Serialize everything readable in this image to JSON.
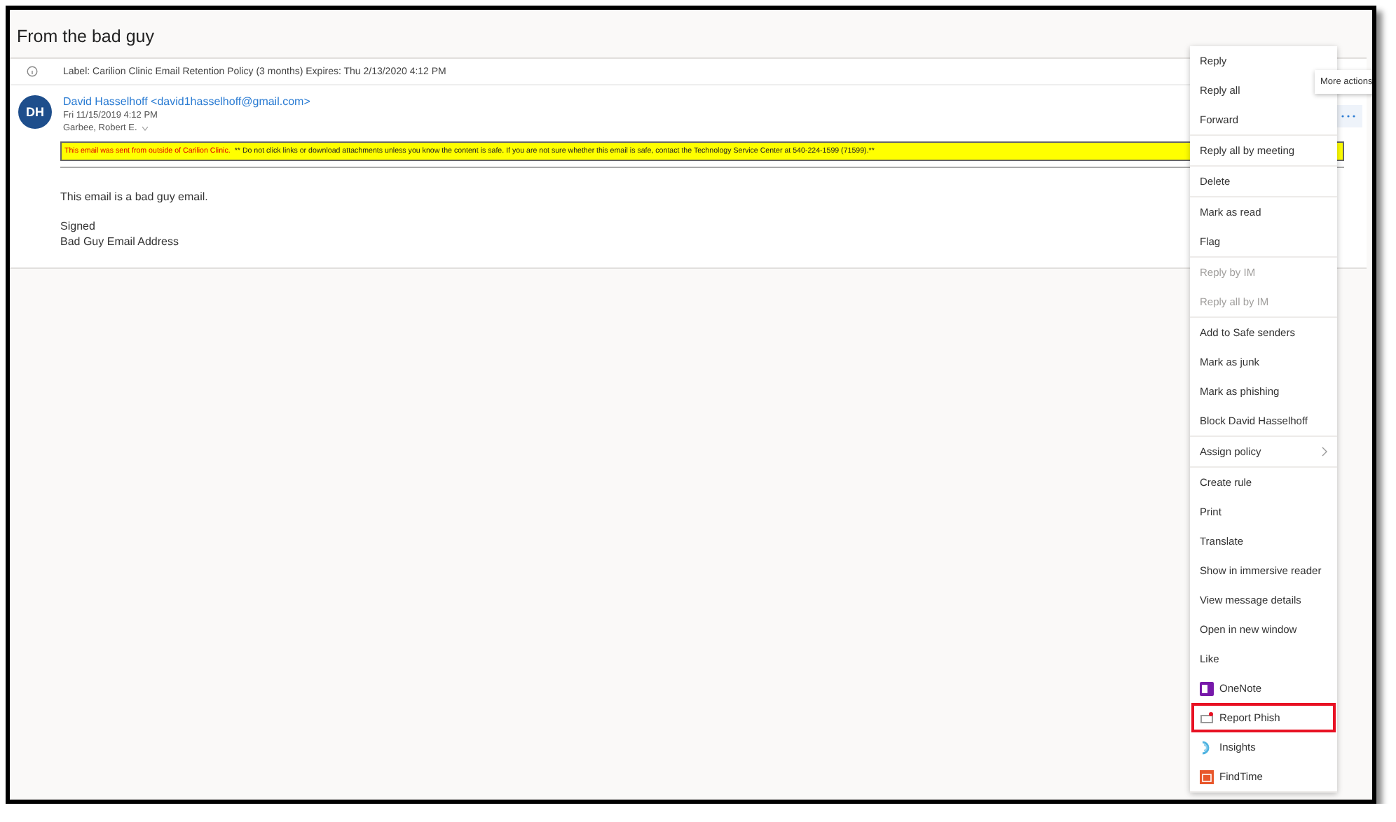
{
  "subject": "From the bad guy",
  "retention_label": "Label: Carilion Clinic Email Retention Policy (3 months) Expires: Thu 2/13/2020 4:12 PM",
  "sender": {
    "initials": "DH",
    "name": "David Hasselhoff <david1hasselhoff@gmail.com>",
    "date": "Fri 11/15/2019 4:12 PM",
    "recipient": "Garbee, Robert E."
  },
  "warning": {
    "lead": "This email was sent from outside of Carilion Clinic.",
    "text": "** Do not click links or download attachments unless you know the content is safe. If you are not sure whether this email is safe, contact the Technology Service Center at 540-224-1599 (71599).**"
  },
  "body": [
    "This email is a bad guy email.",
    "Signed",
    "Bad Guy Email Address"
  ],
  "tooltip": "More actions",
  "menu_groups": [
    [
      {
        "label": "Reply",
        "kind": "plain",
        "disabled": false
      },
      {
        "label": "Reply all",
        "kind": "plain",
        "disabled": false
      },
      {
        "label": "Forward",
        "kind": "plain",
        "disabled": false
      }
    ],
    [
      {
        "label": "Reply all by meeting",
        "kind": "plain",
        "disabled": false
      }
    ],
    [
      {
        "label": "Delete",
        "kind": "plain",
        "disabled": false
      }
    ],
    [
      {
        "label": "Mark as read",
        "kind": "plain",
        "disabled": false
      },
      {
        "label": "Flag",
        "kind": "plain",
        "disabled": false
      }
    ],
    [
      {
        "label": "Reply by IM",
        "kind": "plain",
        "disabled": true
      },
      {
        "label": "Reply all by IM",
        "kind": "plain",
        "disabled": true
      }
    ],
    [
      {
        "label": "Add to Safe senders",
        "kind": "plain",
        "disabled": false
      },
      {
        "label": "Mark as junk",
        "kind": "plain",
        "disabled": false
      },
      {
        "label": "Mark as phishing",
        "kind": "plain",
        "disabled": false
      },
      {
        "label": "Block David Hasselhoff",
        "kind": "plain",
        "disabled": false
      }
    ],
    [
      {
        "label": "Assign policy",
        "kind": "submenu",
        "disabled": false
      }
    ],
    [
      {
        "label": "Create rule",
        "kind": "plain",
        "disabled": false
      },
      {
        "label": "Print",
        "kind": "plain",
        "disabled": false
      },
      {
        "label": "Translate",
        "kind": "plain",
        "disabled": false
      },
      {
        "label": "Show in immersive reader",
        "kind": "plain",
        "disabled": false
      },
      {
        "label": "View message details",
        "kind": "plain",
        "disabled": false
      },
      {
        "label": "Open in new window",
        "kind": "plain",
        "disabled": false
      },
      {
        "label": "Like",
        "kind": "plain",
        "disabled": false
      },
      {
        "label": "OneNote",
        "kind": "onenote",
        "disabled": false
      },
      {
        "label": "Report Phish",
        "kind": "report",
        "disabled": false,
        "highlighted": true
      },
      {
        "label": "Insights",
        "kind": "insights",
        "disabled": false
      },
      {
        "label": "FindTime",
        "kind": "findtime",
        "disabled": false
      }
    ]
  ]
}
